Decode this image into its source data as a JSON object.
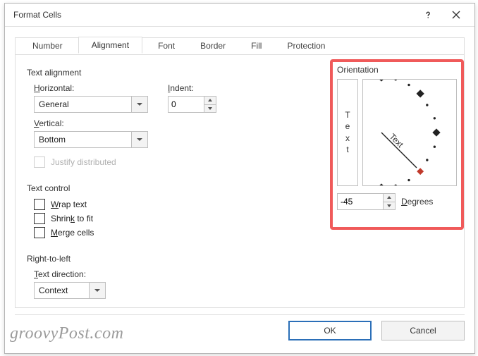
{
  "window": {
    "title": "Format Cells"
  },
  "tabs": [
    "Number",
    "Alignment",
    "Font",
    "Border",
    "Fill",
    "Protection"
  ],
  "alignment": {
    "section_label": "Text alignment",
    "horizontal_label": "Horizontal:",
    "horizontal_value": "General",
    "vertical_label": "Vertical:",
    "vertical_value": "Bottom",
    "indent_label": "Indent:",
    "indent_value": "0",
    "justify_label": "Justify distributed"
  },
  "text_control": {
    "section_label": "Text control",
    "wrap": "Wrap text",
    "shrink": "Shrink to fit",
    "merge": "Merge cells"
  },
  "rtl": {
    "section_label": "Right-to-left",
    "direction_label": "Text direction:",
    "direction_value": "Context"
  },
  "orientation": {
    "section_label": "Orientation",
    "vertical_chars": [
      "T",
      "e",
      "x",
      "t"
    ],
    "dial_word": "Text",
    "degrees_value": "-45",
    "degrees_label": "Degrees"
  },
  "buttons": {
    "ok": "OK",
    "cancel": "Cancel"
  },
  "watermark": "groovyPost.com"
}
